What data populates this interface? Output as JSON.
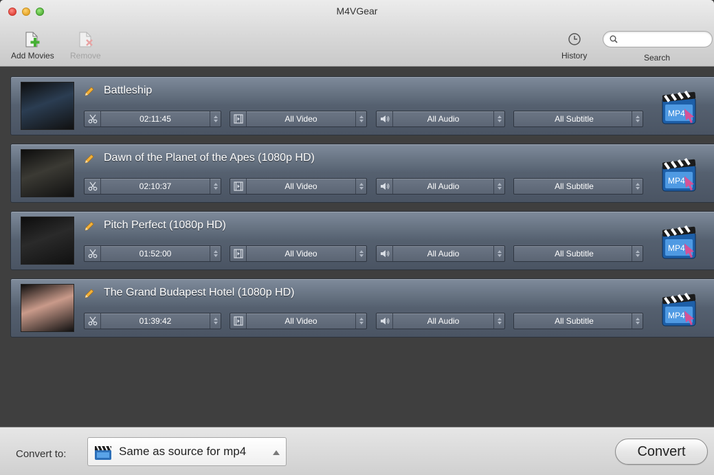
{
  "window": {
    "title": "M4VGear"
  },
  "toolbar": {
    "add_movies": "Add Movies",
    "remove": "Remove",
    "history": "History",
    "search_label": "Search",
    "search_value": ""
  },
  "movies": [
    {
      "title": "Battleship",
      "duration": "02:11:45",
      "video": "All Video",
      "audio": "All Audio",
      "subtitle": "All Subtitle",
      "poster_color": "#2b3d52"
    },
    {
      "title": "Dawn of the Planet of the Apes (1080p HD)",
      "duration": "02:10:37",
      "video": "All Video",
      "audio": "All Audio",
      "subtitle": "All Subtitle",
      "poster_color": "#3b3a34"
    },
    {
      "title": "Pitch Perfect (1080p HD)",
      "duration": "01:52:00",
      "video": "All Video",
      "audio": "All Audio",
      "subtitle": "All Subtitle",
      "poster_color": "#2a2a2a"
    },
    {
      "title": "The Grand Budapest Hotel (1080p HD)",
      "duration": "01:39:42",
      "video": "All Video",
      "audio": "All Audio",
      "subtitle": "All Subtitle",
      "poster_color": "#c99a8a"
    }
  ],
  "mp4_badge": "MP4",
  "bottom": {
    "convert_to_label": "Convert to:",
    "format": "Same as source for mp4",
    "convert_button": "Convert"
  },
  "colors": {
    "row_bg": "#5b6676",
    "accent_green": "#4cb43a",
    "pencil": "#f2b13a"
  }
}
